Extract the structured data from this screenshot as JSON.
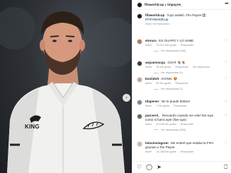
{
  "post": {
    "author": "fifaworldcup",
    "collaborator": "tmpayne_",
    "connector": "y",
    "caption_user": "fifaworldcup",
    "caption_text": "Tuyo asistió. Tim Payne ⚽",
    "hashtag": "#FIFAWorldCup",
    "caption_meta": "5sem  Ver traducción"
  },
  "photo": {
    "shirt_brand": "KING",
    "next_icon": "chevron-right-icon"
  },
  "comments": [
    {
      "user": "eloruru",
      "text": "ES GUAPO Y LO SABE",
      "meta": [
        "5sem",
        "10.513 Me gusta",
        "Responder"
      ],
      "replies": "Ver respuestas (180)",
      "avatar_color": "#b07a5a"
    },
    {
      "user": "anjuamoxuja",
      "text": "GOAT 🐐🐐",
      "meta": [
        "5sem",
        "39 Me gusta",
        "Responder",
        "Ver traducción"
      ],
      "replies": "Ver respuestas (1)",
      "avatar_color": "#3b3b3b"
    },
    {
      "user": "knolidolt",
      "text": "ICONIC 😍",
      "meta": [
        "5sem",
        "80 Me gusta",
        "Responder"
      ],
      "replies": "Ver respuestas (1)",
      "avatar_color": "#c9a48a"
    },
    {
      "user": "tdapener",
      "text": "No lo puede bebere",
      "meta": [
        "4sem",
        "7 Me gusta",
        "Responder"
      ],
      "replies": "",
      "avatar_color": "#7a8a9c"
    },
    {
      "user": "parcerol_",
      "text": "Recuerdo cuando me volví fan tuyo como si fuera ayer (five aye)",
      "meta": [
        "5sem",
        "10.090 Me gusta",
        "Responder"
      ],
      "replies": "Ver respuestas (594)",
      "avatar_color": "#5f6f5a"
    },
    {
      "user": "lulusinstagram",
      "text": "Me enteré que estaba la FIFA gracias a Tim Payne",
      "meta": [
        "5sem",
        "18.768 Me gusta",
        "Responder"
      ],
      "replies": "",
      "avatar_color": "#d6b6a6"
    }
  ],
  "footer": {
    "icons": [
      "heart-icon",
      "comment-icon",
      "share-icon"
    ],
    "bookmark": "bookmark-icon"
  }
}
